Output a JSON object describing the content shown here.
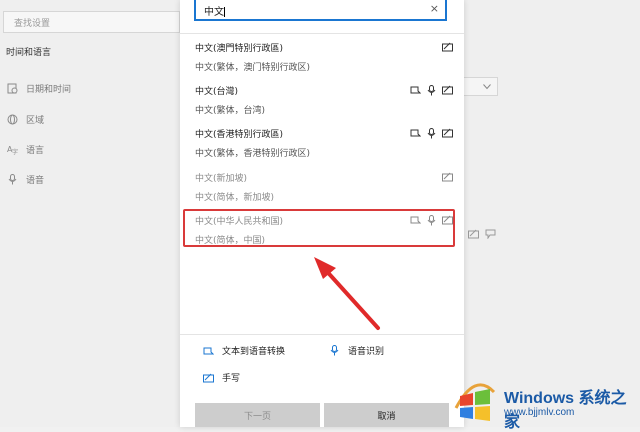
{
  "settings": {
    "search_placeholder": "查找设置",
    "section_title": "时间和语言",
    "nav": [
      {
        "label": "日期和时间",
        "icon": "clock-icon"
      },
      {
        "label": "区域",
        "icon": "globe-icon"
      },
      {
        "label": "语言",
        "icon": "language-icon"
      },
      {
        "label": "语音",
        "icon": "microphone-icon"
      }
    ]
  },
  "dialog": {
    "search_value": "中文",
    "clear_label": "×",
    "languages": [
      {
        "name": "中文(澳門特別行政區)",
        "sub": "中文(繁体，澳门特别行政区)",
        "features": [
          "handwriting"
        ],
        "dim": false
      },
      {
        "name": "中文(台灣)",
        "sub": "中文(繁体，台湾)",
        "features": [
          "tts",
          "speech",
          "handwriting"
        ],
        "dim": false
      },
      {
        "name": "中文(香港特別行政區)",
        "sub": "中文(繁体，香港特别行政区)",
        "features": [
          "tts",
          "speech",
          "handwriting"
        ],
        "dim": false
      },
      {
        "name": "中文(新加坡)",
        "sub": "中文(简体，新加坡)",
        "features": [
          "handwriting"
        ],
        "dim": true
      },
      {
        "name": "中文(中华人民共和国)",
        "sub": "中文(简体，中国)",
        "features": [
          "tts",
          "speech",
          "handwriting"
        ],
        "dim": true
      }
    ],
    "legend": {
      "tts": "文本到语音转换",
      "speech": "语音识别",
      "handwriting": "手写"
    },
    "buttons": {
      "next": "下一页",
      "cancel": "取消"
    }
  },
  "watermark": {
    "title": "Windows 系统之家",
    "url": "www.bjjmlv.com"
  },
  "colors": {
    "accent": "#1a76d1",
    "highlight": "#d93a3a"
  }
}
